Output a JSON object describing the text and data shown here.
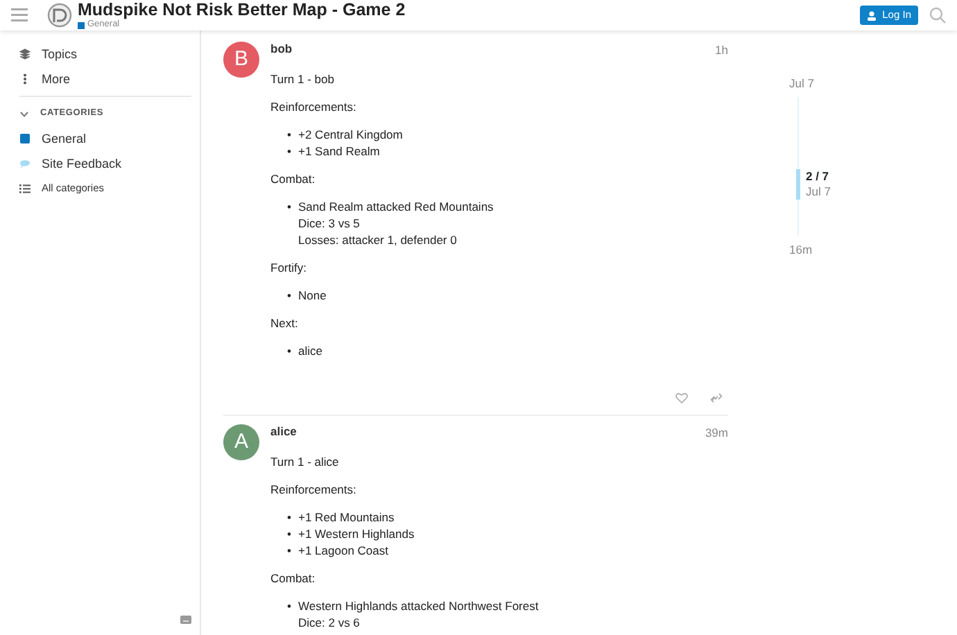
{
  "header": {
    "title": "Mudspike Not Risk Better Map - Game 2",
    "category": {
      "label": "General",
      "color": "#0e76bd"
    },
    "login": "Log In"
  },
  "sidebar": {
    "items": [
      {
        "label": "Topics",
        "kind": "topics"
      },
      {
        "label": "More",
        "kind": "more"
      }
    ],
    "categories_heading": {
      "label": "CATEGORIES",
      "expanded": true
    },
    "categories": [
      {
        "label": "General",
        "kind": "category",
        "color": "#0e76bd"
      },
      {
        "label": "Site Feedback",
        "kind": "feedback",
        "color": "#a8dcf5"
      },
      {
        "label": "All categories",
        "kind": "all"
      }
    ]
  },
  "posts": [
    {
      "author": "bob",
      "avatar": "B",
      "color": "#e45b63",
      "time": "1h",
      "blocks": [
        {
          "kind": "para",
          "text": "Turn 1 - bob"
        },
        {
          "kind": "para",
          "text": "Reinforcements:"
        },
        {
          "kind": "list",
          "marker": "•",
          "items": [
            [
              "+2 Central Kingdom"
            ],
            [
              "+1 Sand Realm"
            ]
          ]
        },
        {
          "kind": "para",
          "text": "Combat:"
        },
        {
          "kind": "list",
          "marker": "•",
          "items": [
            [
              "Sand Realm attacked Red Mountains",
              "Dice: 3 vs 5",
              "Losses: attacker 1, defender 0"
            ]
          ]
        },
        {
          "kind": "para",
          "text": "Fortify:"
        },
        {
          "kind": "list",
          "marker": "•",
          "items": [
            [
              "None"
            ]
          ]
        },
        {
          "kind": "para",
          "text": "Next:"
        },
        {
          "kind": "list",
          "marker": "•",
          "items": [
            [
              "alice"
            ]
          ]
        }
      ],
      "actions": true
    },
    {
      "author": "alice",
      "avatar": "A",
      "color": "#6c9a73",
      "time": "39m",
      "blocks": [
        {
          "kind": "para",
          "text": "Turn 1 - alice"
        },
        {
          "kind": "para",
          "text": "Reinforcements:"
        },
        {
          "kind": "list",
          "marker": "•",
          "items": [
            [
              "+1 Red Mountains"
            ],
            [
              "+1 Western Highlands"
            ],
            [
              "+1 Lagoon Coast"
            ]
          ]
        },
        {
          "kind": "para",
          "text": "Combat:"
        },
        {
          "kind": "list",
          "marker": "•",
          "items": [
            [
              "Western Highlands attacked Northwest Forest",
              "Dice: 2 vs 6"
            ]
          ]
        }
      ],
      "actions": false
    }
  ],
  "timeline": {
    "start": "Jul 7",
    "position": "2 / 7",
    "position_date": "Jul 7",
    "end": "16m"
  }
}
